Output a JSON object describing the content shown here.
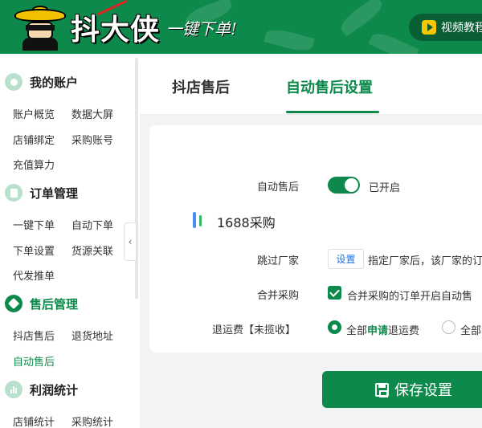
{
  "header": {
    "logo_text": "抖大侠",
    "slogan": "一键下单!",
    "video_button_label": "视频教程"
  },
  "sidebar": {
    "groups": [
      {
        "title": "我的账户",
        "icon": "user-icon",
        "items": [
          "账户概览",
          "数据大屏",
          "店铺绑定",
          "采购账号",
          "充值算力"
        ]
      },
      {
        "title": "订单管理",
        "icon": "order-icon",
        "items": [
          "一键下单",
          "自动下单",
          "下单设置",
          "货源关联",
          "代发推单"
        ]
      },
      {
        "title": "售后管理",
        "icon": "tag-icon",
        "items": [
          "抖店售后",
          "退货地址",
          "自动售后"
        ]
      },
      {
        "title": "利润统计",
        "icon": "chart-icon",
        "items": [
          "店铺统计",
          "采购统计"
        ]
      }
    ],
    "collapse_glyph": "‹"
  },
  "tabs": [
    {
      "label": "抖店售后",
      "active": false
    },
    {
      "label": "自动售后设置",
      "active": true
    }
  ],
  "settings": {
    "auto_aftersale_label": "自动售后",
    "auto_aftersale_status": "已开启",
    "section_title": "1688采购",
    "skip_vendor_label": "跳过厂家",
    "skip_vendor_button": "设置",
    "skip_vendor_desc": "指定厂家后，该厂家的订",
    "merge_label": "合并采购",
    "merge_desc": "合并采购的订单开启自动售",
    "shipping_label": "退运费【未揽收】",
    "shipping_options": [
      {
        "prefix": "全部",
        "highlight": "申请",
        "suffix": "退运费",
        "selected": true
      },
      {
        "prefix": "全部",
        "highlight": "",
        "suffix": "",
        "selected": false
      }
    ]
  },
  "save_button_label": "保存设置",
  "colors": {
    "brand_green": "#0d8a4b",
    "link_blue": "#1a73e8"
  }
}
